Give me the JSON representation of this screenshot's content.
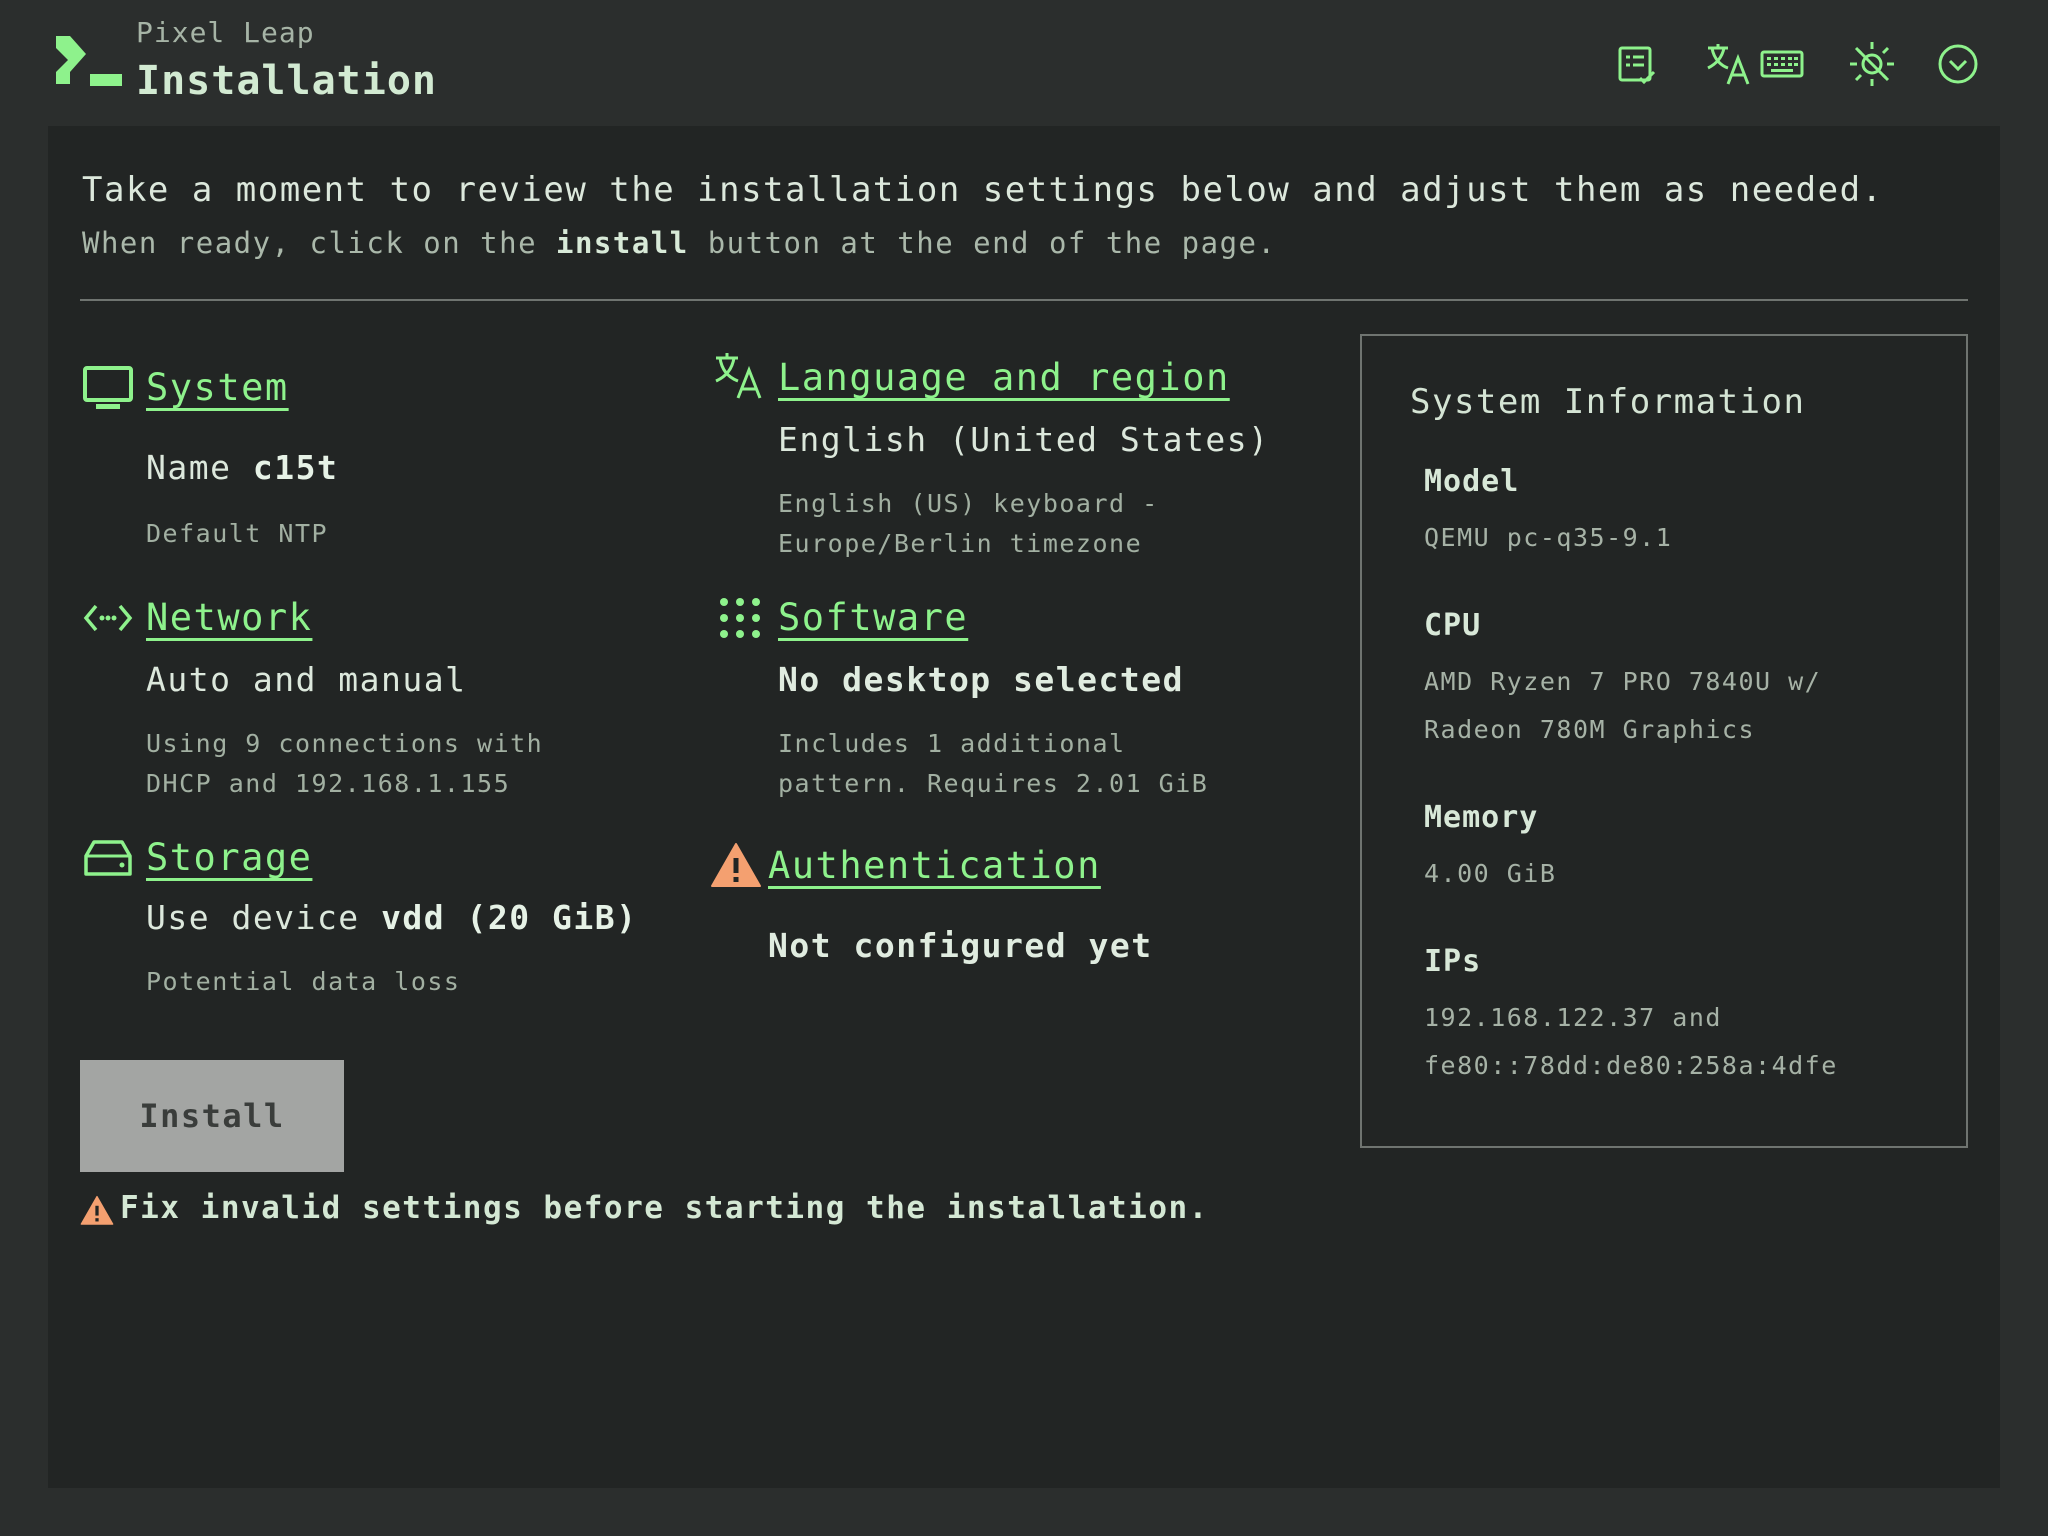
{
  "header": {
    "product_name": "Pixel Leap",
    "title": "Installation",
    "icons": [
      "installer-options-icon",
      "language-icon",
      "keyboard-icon",
      "theme-icon",
      "menu-icon"
    ],
    "accent_color": "#8ef28c"
  },
  "intro": {
    "line1": "Take a moment to review the installation settings below and adjust them as needed.",
    "line2_prefix": "When ready, click on the",
    "line2_bold": "install",
    "line2_suffix": "button at the end of the page."
  },
  "sections": {
    "system": {
      "title": "System",
      "name_label": "Name",
      "name_value": "c15t",
      "detail": "Default NTP"
    },
    "language": {
      "title": "Language and region",
      "main": "English (United States)",
      "detail_line1": "English (US) keyboard -",
      "detail_line2": "Europe/Berlin timezone"
    },
    "network": {
      "title": "Network",
      "main": "Auto and manual",
      "detail_line1": "Using 9 connections with",
      "detail_line2": "DHCP and 192.168.1.155"
    },
    "software": {
      "title": "Software",
      "main": "No desktop selected",
      "detail_line1": "Includes 1 additional",
      "detail_line2": "pattern. Requires 2.01 GiB"
    },
    "storage": {
      "title": "Storage",
      "main_prefix": "Use device",
      "main_bold": "vdd (20 GiB)",
      "detail": "Potential data loss"
    },
    "authentication": {
      "title": "Authentication",
      "main": "Not configured yet",
      "warning_color": "#f4a070"
    }
  },
  "install": {
    "button_label": "Install",
    "warning": "Fix invalid settings before starting the installation."
  },
  "system_information": {
    "title": "System Information",
    "model_label": "Model",
    "model_value": "QEMU pc-q35-9.1",
    "cpu_label": "CPU",
    "cpu_value_line1": "AMD Ryzen 7 PRO 7840U w/",
    "cpu_value_line2": "Radeon 780M Graphics",
    "memory_label": "Memory",
    "memory_value": "4.00 GiB",
    "ips_label": "IPs",
    "ips_value_line1": "192.168.122.37 and",
    "ips_value_line2": "fe80::78dd:de80:258a:4dfe"
  }
}
